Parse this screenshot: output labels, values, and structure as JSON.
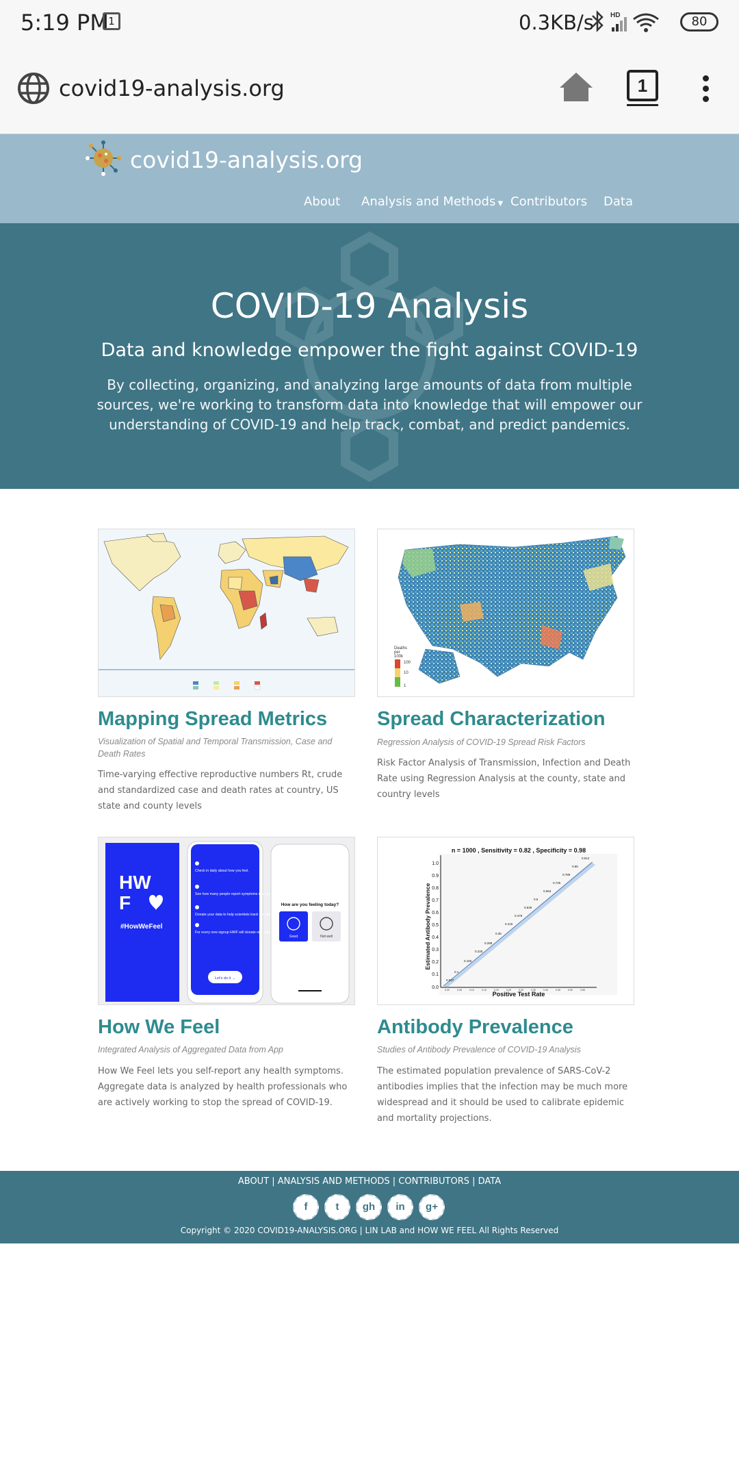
{
  "status_bar": {
    "time": "5:19 PM",
    "calendar_day": "1",
    "net_speed": "0.3KB/s",
    "battery": "80"
  },
  "browser": {
    "url": "covid19-analysis.org",
    "tab_count": "1"
  },
  "site": {
    "title": "covid19-analysis.org",
    "nav": [
      "About",
      "Analysis and Methods",
      "Contributors",
      "Data"
    ]
  },
  "hero": {
    "title": "COVID-19 Analysis",
    "subtitle": "Data and knowledge empower the fight against COVID-19",
    "description": "By collecting, organizing, and analyzing large amounts of data from multiple sources, we're working to transform data into knowledge that will empower our understanding of COVID-19 and help track, combat, and predict pandemics."
  },
  "cards": [
    {
      "title": "Mapping Spread Metrics",
      "subtitle": "Visualization of Spatial and Temporal Transmission, Case and Death Rates",
      "description": "Time-varying effective reproductive numbers Rt, crude and standardized case and death rates at country, US state and county levels"
    },
    {
      "title": "Spread Characterization",
      "subtitle": "Regression Analysis of COVID-19 Spread Risk Factors",
      "description": "Risk Factor Analysis of Transmission, Infection and Death Rate using Regression Analysis at the county, state and country levels"
    },
    {
      "title": "How We Feel",
      "subtitle": "Integrated Analysis of Aggregated Data from App",
      "description": "How We Feel lets you self-report any health symptoms. Aggregate data is analyzed by health professionals who are actively working to stop the spread of COVID-19."
    },
    {
      "title": "Antibody Prevalence",
      "subtitle": "Studies of Antibody Prevalence of COVID-19 Analysis",
      "description": "The estimated population prevalence of SARS-CoV-2 antibodies implies that the infection may be much more widespread and it should be used to calibrate epidemic and mortality projections."
    }
  ],
  "thumbnails": {
    "us_map_legend": [
      "Deaths",
      "per",
      "100k",
      "100",
      "10",
      "1"
    ],
    "hwf_logo": [
      "HW",
      "F",
      "#HowWeFeel"
    ],
    "hwf_phone1": [
      "Check in daily about how you feel.",
      "See how many people report symptoms near you.",
      "Donate your data to help scientists track the virus.",
      "For every new signup HWF will donate one meal to a person in need.",
      "Let's do it →"
    ],
    "hwf_phone2": [
      "How are you feeling today?",
      "Good",
      "Not well"
    ],
    "antibody_chart_title": "n =  1000 , Sensitivity =  0.82 , Specificity =  0.98",
    "antibody_xlabel": "Positive Test Rate",
    "antibody_ylabel": "Estimated Antibody Prevalence"
  },
  "footer": {
    "links": "ABOUT | ANALYSIS AND METHODS | CONTRIBUTORS | DATA",
    "social": [
      "f",
      "t",
      "gh",
      "in",
      "g+"
    ],
    "copyright": "Copyright © 2020 COVID19-ANALYSIS.ORG | LIN LAB and HOW WE FEEL All Rights Reserved"
  },
  "colors": {
    "header_bg": "#9ab9cb",
    "hero_bg": "#3f7585",
    "card_title": "#2e8b8e",
    "footer_bg": "#3f7585"
  }
}
